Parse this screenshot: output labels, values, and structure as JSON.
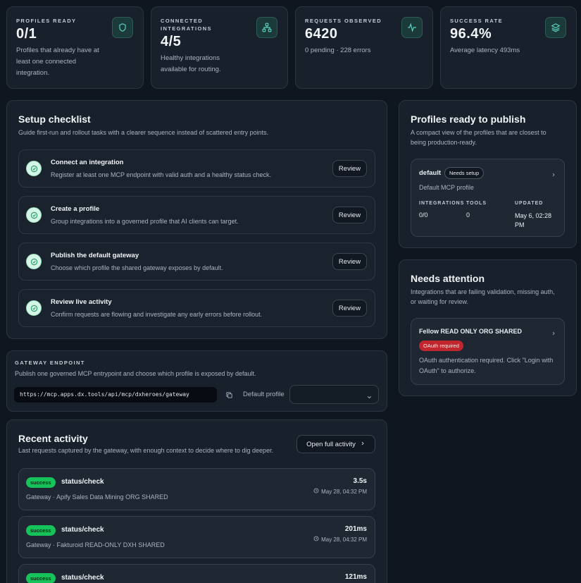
{
  "stats": [
    {
      "label": "PROFILES READY",
      "value": "0/1",
      "sub": "Profiles that already have at least one connected integration.",
      "icon": "shield-icon"
    },
    {
      "label": "CONNECTED INTEGRATIONS",
      "value": "4/5",
      "sub": "Healthy integrations available for routing.",
      "icon": "network-icon"
    },
    {
      "label": "REQUESTS OBSERVED",
      "value": "6420",
      "sub": "0 pending · 228 errors",
      "icon": "activity-icon"
    },
    {
      "label": "SUCCESS RATE",
      "value": "96.4%",
      "sub": "Average latency 493ms",
      "icon": "layers-icon"
    }
  ],
  "checklist": {
    "title": "Setup checklist",
    "description": "Guide first-run and rollout tasks with a clearer sequence instead of scattered entry points.",
    "items": [
      {
        "title": "Connect an integration",
        "desc": "Register at least one MCP endpoint with valid auth and a healthy status check.",
        "button": "Review"
      },
      {
        "title": "Create a profile",
        "desc": "Group integrations into a governed profile that AI clients can target.",
        "button": "Review"
      },
      {
        "title": "Publish the default gateway",
        "desc": "Choose which profile the shared gateway exposes by default.",
        "button": "Review"
      },
      {
        "title": "Review live activity",
        "desc": "Confirm requests are flowing and investigate any early errors before rollout.",
        "button": "Review"
      }
    ]
  },
  "gateway": {
    "label": "GATEWAY ENDPOINT",
    "description": "Publish one governed MCP entrypoint and choose which profile is exposed by default.",
    "url": "https://mcp.apps.dx.tools/api/mcp/dxheroes/gateway",
    "default_profile_label": "Default profile",
    "default_profile_value": ""
  },
  "activity": {
    "title": "Recent activity",
    "description": "Last requests captured by the gateway, with enough context to decide where to dig deeper.",
    "open_button": "Open full activity",
    "items": [
      {
        "status": "success",
        "path": "status/check",
        "gateway": "Gateway · Apify Sales Data Mining ORG SHARED",
        "duration": "3.5s",
        "time": "May 28, 04:32 PM"
      },
      {
        "status": "success",
        "path": "status/check",
        "gateway": "Gateway · Fakturoid READ-ONLY DXH SHARED",
        "duration": "201ms",
        "time": "May 28, 04:32 PM"
      },
      {
        "status": "success",
        "path": "status/check",
        "gateway": "",
        "duration": "121ms",
        "time": ""
      }
    ]
  },
  "profiles": {
    "title": "Profiles ready to publish",
    "description": "A compact view of the profiles that are closest to being production-ready.",
    "card": {
      "name": "default",
      "badge": "Needs setup",
      "desc": "Default MCP profile",
      "col_integrations": "INTEGRATIONS",
      "col_tools": "TOOLS",
      "col_updated": "UPDATED",
      "integrations": "0/0",
      "tools": "0",
      "updated": "May 6, 02:28 PM"
    }
  },
  "attention": {
    "title": "Needs attention",
    "description": "Integrations that are failing validation, missing auth, or waiting for review.",
    "card": {
      "name": "Fellow READ ONLY ORG SHARED",
      "badge": "OAuth required",
      "desc": "OAuth authentication required. Click \"Login with OAuth\" to authorize."
    }
  },
  "colors": {
    "accent_teal": "#5fd3c4",
    "success_green": "#16c25a",
    "danger_red": "#c0262d",
    "background": "#0f1620",
    "card": "#18212b"
  }
}
